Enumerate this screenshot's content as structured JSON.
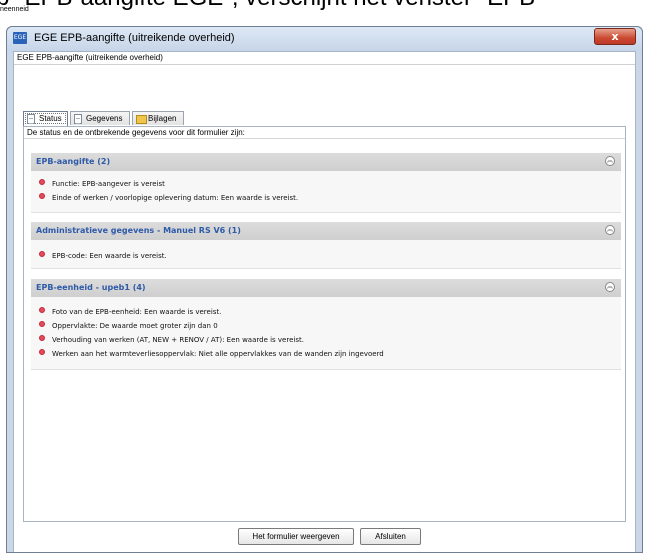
{
  "background": {
    "cropped_text": "p \"EPB-aangifte EGE\", verschijnt het venster \"EPB",
    "small_text": "neenneid"
  },
  "window": {
    "app_icon_text": "EGE",
    "title": "EGE EPB-aangifte (uitreikende overheid)",
    "close_glyph": "x",
    "subtitle": "EGE EPB-aangifte (uitreikende overheid)"
  },
  "tabs": [
    {
      "label": "Status",
      "icon": "document-icon",
      "active": true
    },
    {
      "label": "Gegevens",
      "icon": "document-icon",
      "active": false
    },
    {
      "label": "Bijlagen",
      "icon": "folder-icon",
      "active": false
    }
  ],
  "content": {
    "intro": "De status en de ontbrekende gegevens voor dit formulier zijn:",
    "collapse_glyph": "︽",
    "sections": [
      {
        "title": "EPB-aangifte (2)",
        "items": [
          "Functie: EPB-aangever is vereist",
          "Einde of werken / voorlopige oplevering datum: Een waarde is vereist."
        ]
      },
      {
        "title": "Administratieve gegevens - Manuel RS V6 (1)",
        "items": [
          "EPB-code: Een waarde is vereist."
        ]
      },
      {
        "title": "EPB-eenheid - upeb1 (4)",
        "items": [
          "Foto van de EPB-eenheid: Een waarde is vereist.",
          "Oppervlakte: De waarde moet groter zijn dan 0",
          "Verhouding van werken (AT, NEW + RENOV / AT): Een waarde is vereist.",
          "Werken aan het warmteverliesoppervlak: Niet alle oppervlakkes van de wanden zijn ingevoerd"
        ]
      }
    ]
  },
  "footer": {
    "show_form_label": "Het formulier weergeven",
    "close_label": "Afsluiten"
  },
  "colors": {
    "section_title": "#2e5aa8",
    "bullet": "#e34b5b",
    "close_button": "#c94a30"
  }
}
